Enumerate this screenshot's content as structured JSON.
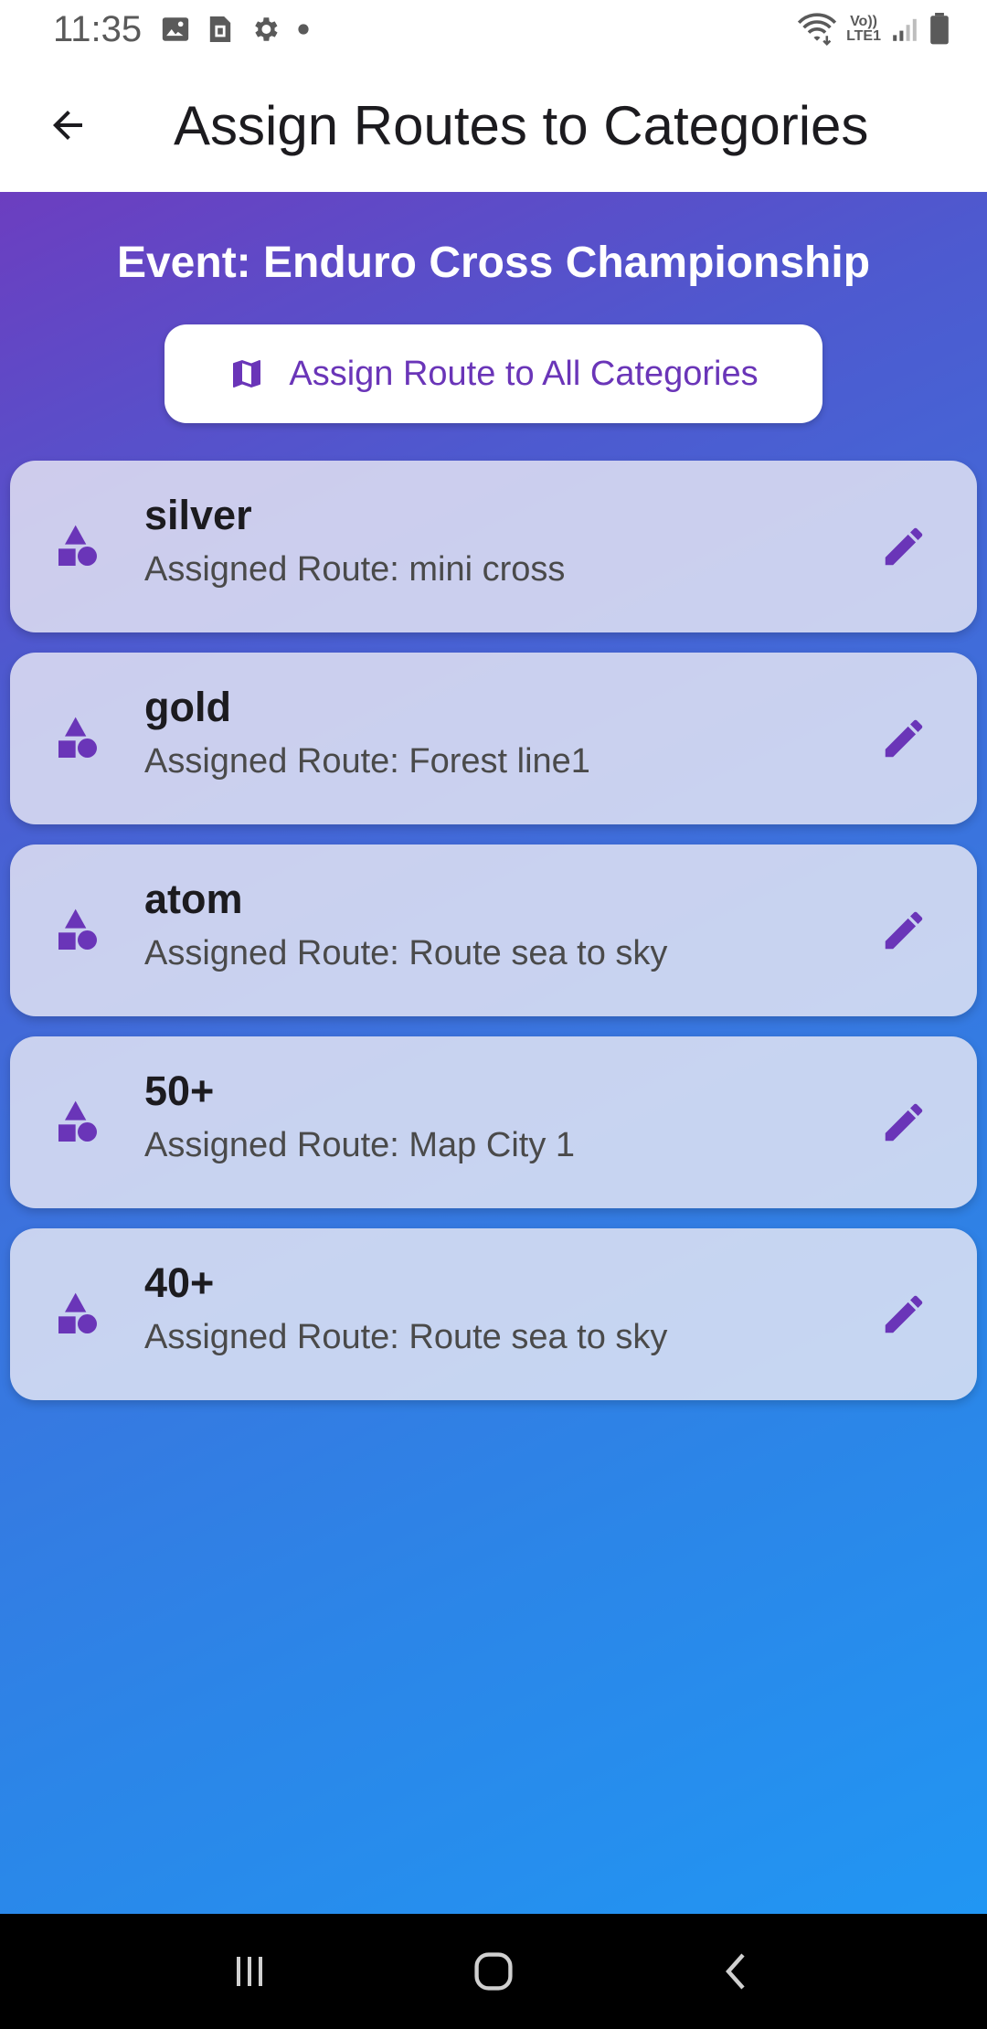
{
  "status_bar": {
    "time": "11:35",
    "lte_top": "Vo))",
    "lte_bottom": "LTE1",
    "icons": [
      "gallery-icon",
      "sim-card-icon",
      "settings-icon",
      "dot-icon",
      "wifi-icon",
      "signal-icon",
      "battery-icon"
    ]
  },
  "app_bar": {
    "title": "Assign Routes to Categories",
    "back_icon": "arrow-back-icon"
  },
  "main": {
    "event_title": "Event: Enduro Cross Championship",
    "assign_all_label": "Assign Route to All Categories",
    "assign_all_icon": "map-icon"
  },
  "categories": [
    {
      "name": "silver",
      "route": "Assigned Route: mini cross"
    },
    {
      "name": "gold",
      "route": "Assigned Route: Forest line1"
    },
    {
      "name": "atom",
      "route": "Assigned Route: Route sea to sky"
    },
    {
      "name": "50+",
      "route": "Assigned Route: Map City 1"
    },
    {
      "name": "40+",
      "route": "Assigned Route: Route sea to sky"
    }
  ],
  "colors": {
    "accent": "#6a35b8",
    "gradient_start": "#6c3ec0",
    "gradient_end": "#2196f3"
  },
  "nav_bar": {
    "icons": [
      "recent-apps-icon",
      "home-icon",
      "back-icon"
    ]
  }
}
